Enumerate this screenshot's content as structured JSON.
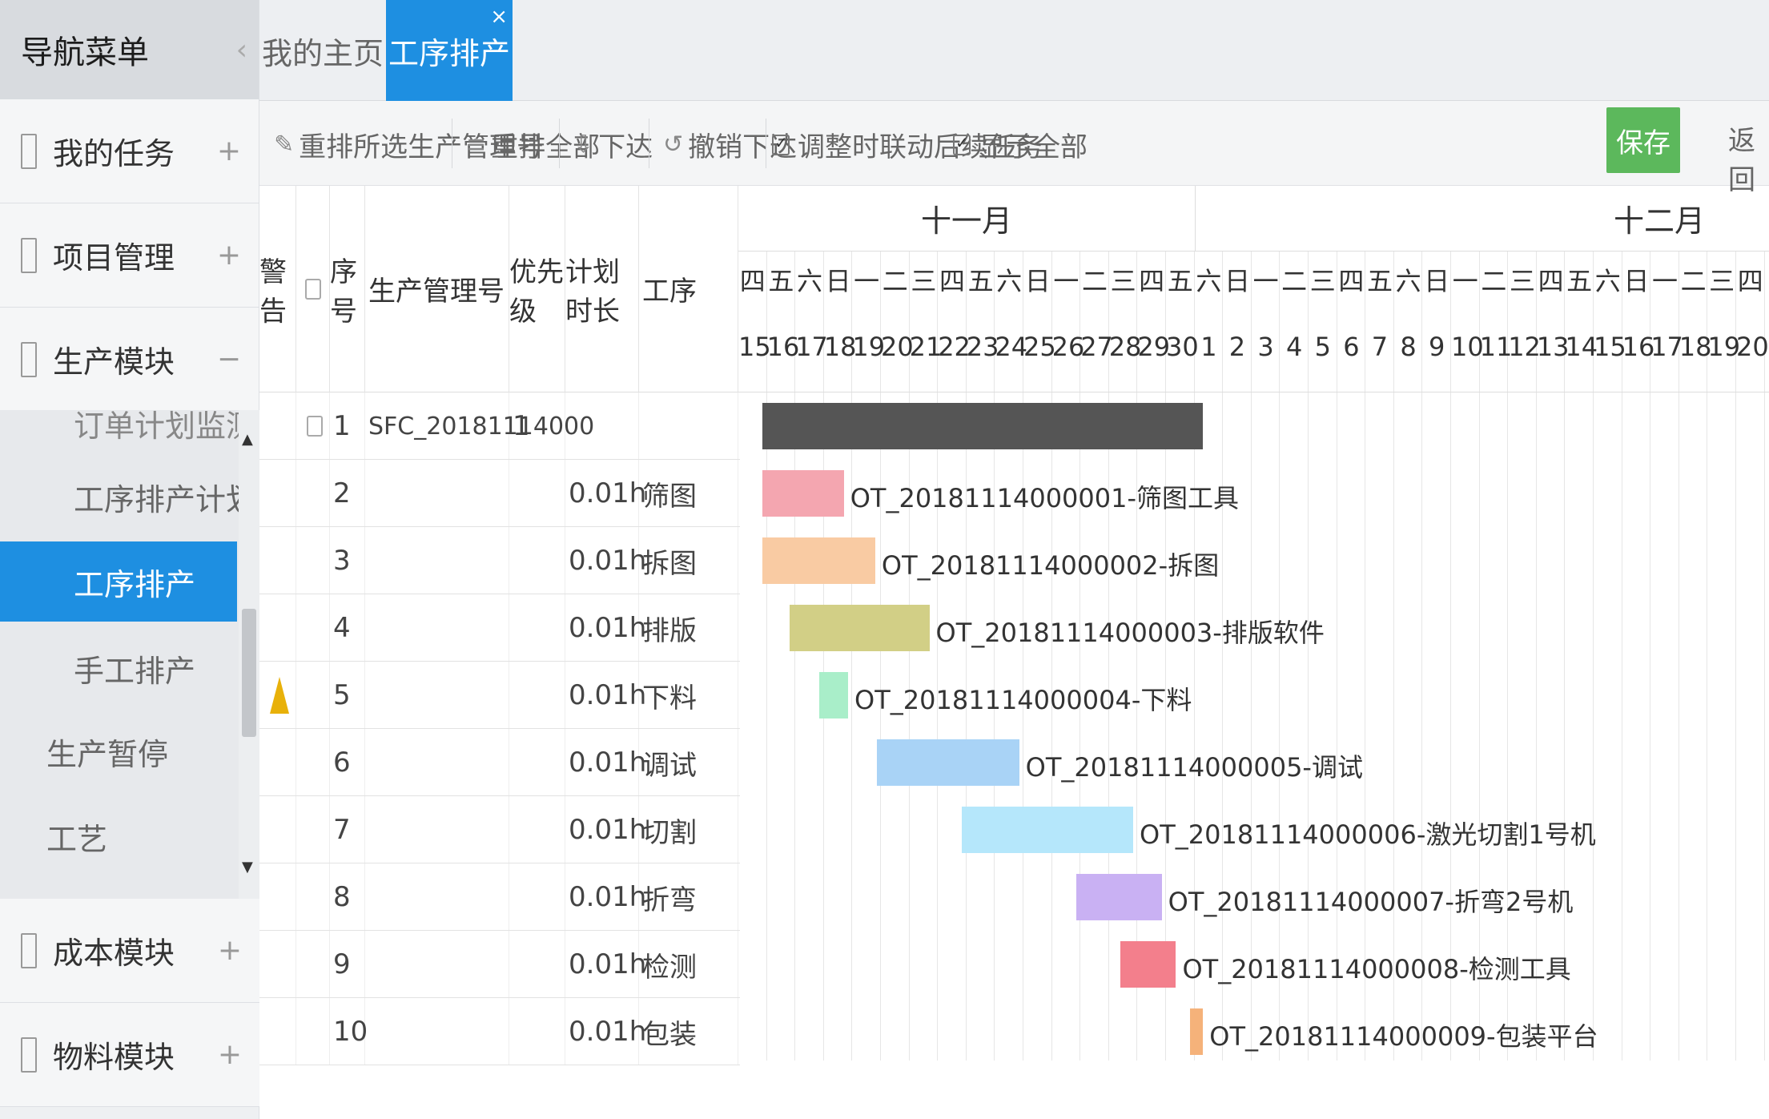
{
  "sidebar": {
    "title": "导航菜单",
    "collapse_icon": "‹",
    "groups": [
      {
        "label": "我的任务",
        "toggle": "+"
      },
      {
        "label": "项目管理",
        "toggle": "+"
      },
      {
        "label": "生产模块",
        "toggle": "−"
      },
      {
        "label": "成本模块",
        "toggle": "+"
      },
      {
        "label": "物料模块",
        "toggle": "+"
      }
    ],
    "sub_items": [
      "订单计划监测",
      "工序排产计划",
      "工序排产",
      "手工排产",
      "生产暂停",
      "工艺"
    ],
    "scroll_up": "▲",
    "scroll_down": "▼"
  },
  "tabs": {
    "home": "我的主页",
    "active": "工序排产",
    "close": "×"
  },
  "toolbar": {
    "reschedule_selected": "重排所选生产管理号",
    "reschedule_all": "重排全部",
    "release": "下达",
    "cancel_release": "撤销下达",
    "link_subsequent": "调整时联动后续任务",
    "show_all": "显示全部",
    "save": "保存",
    "back": "返回"
  },
  "columns": {
    "warning": "警告",
    "seq": "序号",
    "order_no": "生产管理号",
    "priority": "优先级",
    "duration": "计划时长",
    "process": "工序"
  },
  "rows": [
    {
      "seq": "1",
      "order_no": "SFC_20181114000",
      "priority": "1",
      "duration": "",
      "process": "",
      "checkbox": true,
      "warn": false
    },
    {
      "seq": "2",
      "order_no": "",
      "priority": "",
      "duration": "0.01h",
      "process": "筛图",
      "checkbox": false,
      "warn": false
    },
    {
      "seq": "3",
      "order_no": "",
      "priority": "",
      "duration": "0.01h",
      "process": "拆图",
      "checkbox": false,
      "warn": false
    },
    {
      "seq": "4",
      "order_no": "",
      "priority": "",
      "duration": "0.01h",
      "process": "排版",
      "checkbox": false,
      "warn": false
    },
    {
      "seq": "5",
      "order_no": "",
      "priority": "",
      "duration": "0.01h",
      "process": "下料",
      "checkbox": false,
      "warn": true
    },
    {
      "seq": "6",
      "order_no": "",
      "priority": "",
      "duration": "0.01h",
      "process": "调试",
      "checkbox": false,
      "warn": false
    },
    {
      "seq": "7",
      "order_no": "",
      "priority": "",
      "duration": "0.01h",
      "process": "切割",
      "checkbox": false,
      "warn": false
    },
    {
      "seq": "8",
      "order_no": "",
      "priority": "",
      "duration": "0.01h",
      "process": "折弯",
      "checkbox": false,
      "warn": false
    },
    {
      "seq": "9",
      "order_no": "",
      "priority": "",
      "duration": "0.01h",
      "process": "检测",
      "checkbox": false,
      "warn": false
    },
    {
      "seq": "10",
      "order_no": "",
      "priority": "",
      "duration": "0.01h",
      "process": "包装",
      "checkbox": false,
      "warn": false
    }
  ],
  "gantt": {
    "months": [
      "十一月",
      "十二月"
    ],
    "weekdays": [
      "四",
      "五",
      "六",
      "日",
      "一",
      "二",
      "三",
      "四",
      "五",
      "六",
      "日",
      "一",
      "二",
      "三",
      "四",
      "五",
      "六",
      "日",
      "一",
      "二",
      "三",
      "四",
      "五",
      "六",
      "日",
      "一",
      "二",
      "三",
      "四",
      "五",
      "六",
      "日",
      "一",
      "二",
      "三",
      "四"
    ],
    "days": [
      "15",
      "16",
      "17",
      "18",
      "19",
      "20",
      "21",
      "22",
      "23",
      "24",
      "25",
      "26",
      "27",
      "28",
      "29",
      "30",
      "1",
      "2",
      "3",
      "4",
      "5",
      "6",
      "7",
      "8",
      "9",
      "10",
      "11",
      "12",
      "13",
      "14",
      "15",
      "16",
      "17",
      "18",
      "19",
      "20"
    ],
    "tasks": [
      {
        "label": "",
        "color": "#555555",
        "start": 0.85,
        "end": 16.3
      },
      {
        "label": "OT_20181114000001-筛图工具",
        "color": "#f4a6b0",
        "start": 0.85,
        "end": 3.7
      },
      {
        "label": "OT_20181114000002-拆图",
        "color": "#f9cba3",
        "start": 0.85,
        "end": 4.8
      },
      {
        "label": "OT_20181114000003-排版软件",
        "color": "#d2cf86",
        "start": 1.8,
        "end": 6.7
      },
      {
        "label": "OT_20181114000004-下料",
        "color": "#a9eec9",
        "start": 2.85,
        "end": 3.85
      },
      {
        "label": "OT_20181114000005-调试",
        "color": "#a9d3f6",
        "start": 4.85,
        "end": 9.85
      },
      {
        "label": "OT_20181114000006-激光切割1号机",
        "color": "#b5e7fb",
        "start": 7.85,
        "end": 13.85
      },
      {
        "label": "OT_20181114000007-折弯2号机",
        "color": "#c9b1f3",
        "start": 11.85,
        "end": 14.85
      },
      {
        "label": "OT_20181114000008-检测工具",
        "color": "#f37f8c",
        "start": 13.4,
        "end": 15.35
      },
      {
        "label": "OT_20181114000009-包装平台",
        "color": "#f5b27a",
        "start": 15.85,
        "end": 16.3
      }
    ]
  }
}
